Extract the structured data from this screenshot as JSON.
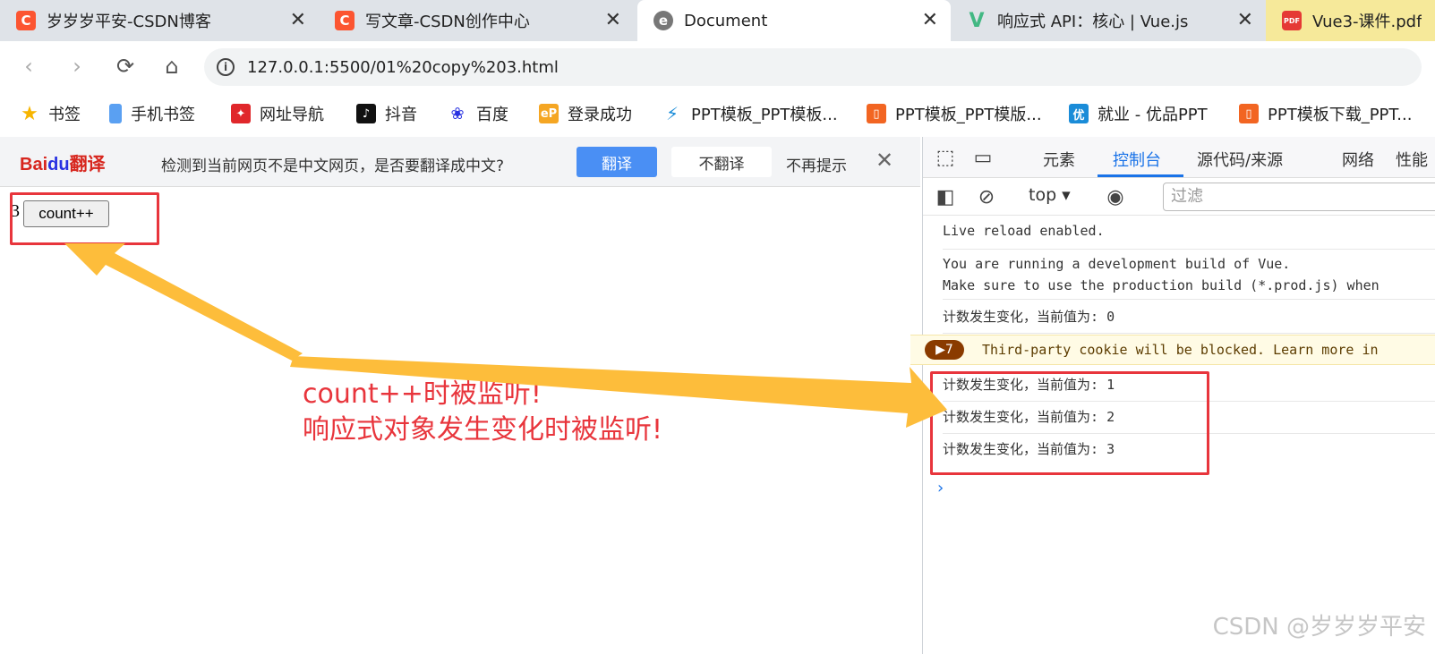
{
  "tabs": [
    {
      "title": "岁岁岁平安-CSDN博客",
      "favicon": "C",
      "color": "#fc5531"
    },
    {
      "title": "写文章-CSDN创作中心",
      "favicon": "C",
      "color": "#fc5531"
    },
    {
      "title": "Document",
      "favicon": "e",
      "color": "#777"
    },
    {
      "title": "响应式 API：核心 | Vue.js",
      "favicon": "V",
      "color": "#42b883"
    },
    {
      "title": "Vue3-课件.pdf",
      "favicon": "PDF",
      "color": "#e53935"
    }
  ],
  "address": {
    "url": "127.0.0.1:5500/01%20copy%203.html"
  },
  "bookmarks": [
    {
      "label": "书签"
    },
    {
      "label": "手机书签"
    },
    {
      "label": "网址导航"
    },
    {
      "label": "抖音"
    },
    {
      "label": "百度"
    },
    {
      "label": "登录成功"
    },
    {
      "label": "PPT模板_PPT模板..."
    },
    {
      "label": "PPT模板_PPT模版..."
    },
    {
      "label": "就业 - 优品PPT"
    },
    {
      "label": "PPT模板下载_PPT..."
    }
  ],
  "translate_bar": {
    "logo": "Bai",
    "logo_paw": "du",
    "logo_suffix": "翻译",
    "message": "检测到当前网页不是中文网页，是否要翻译成中文?",
    "translate_label": "翻译",
    "no_translate_label": "不翻译",
    "never_label": "不再提示"
  },
  "page": {
    "count_value": "3",
    "button_label": "count++",
    "annotation_line1": "count++时被监听!",
    "annotation_line2": "响应式对象发生变化时被监听!"
  },
  "devtools": {
    "tabs": [
      "元素",
      "控制台",
      "源代码/来源",
      "网络",
      "性能"
    ],
    "active_tab": "控制台",
    "context": "top",
    "filter_placeholder": "过滤",
    "logs": [
      "Live reload enabled.",
      "You are running a development build of Vue.",
      "Make sure to use the production build (*.prod.js) when",
      "计数发生变化，当前值为: 0",
      "计数发生变化，当前值为: 1",
      "计数发生变化，当前值为: 2",
      "计数发生变化，当前值为: 3"
    ],
    "warning_count": "7",
    "warning_text": "Third-party cookie will be blocked. Learn more in"
  },
  "watermark": "CSDN @岁岁岁平安",
  "colors": {
    "annotation": "#e8353c",
    "arrow": "#fdbd3b",
    "accent": "#1a73e8"
  }
}
